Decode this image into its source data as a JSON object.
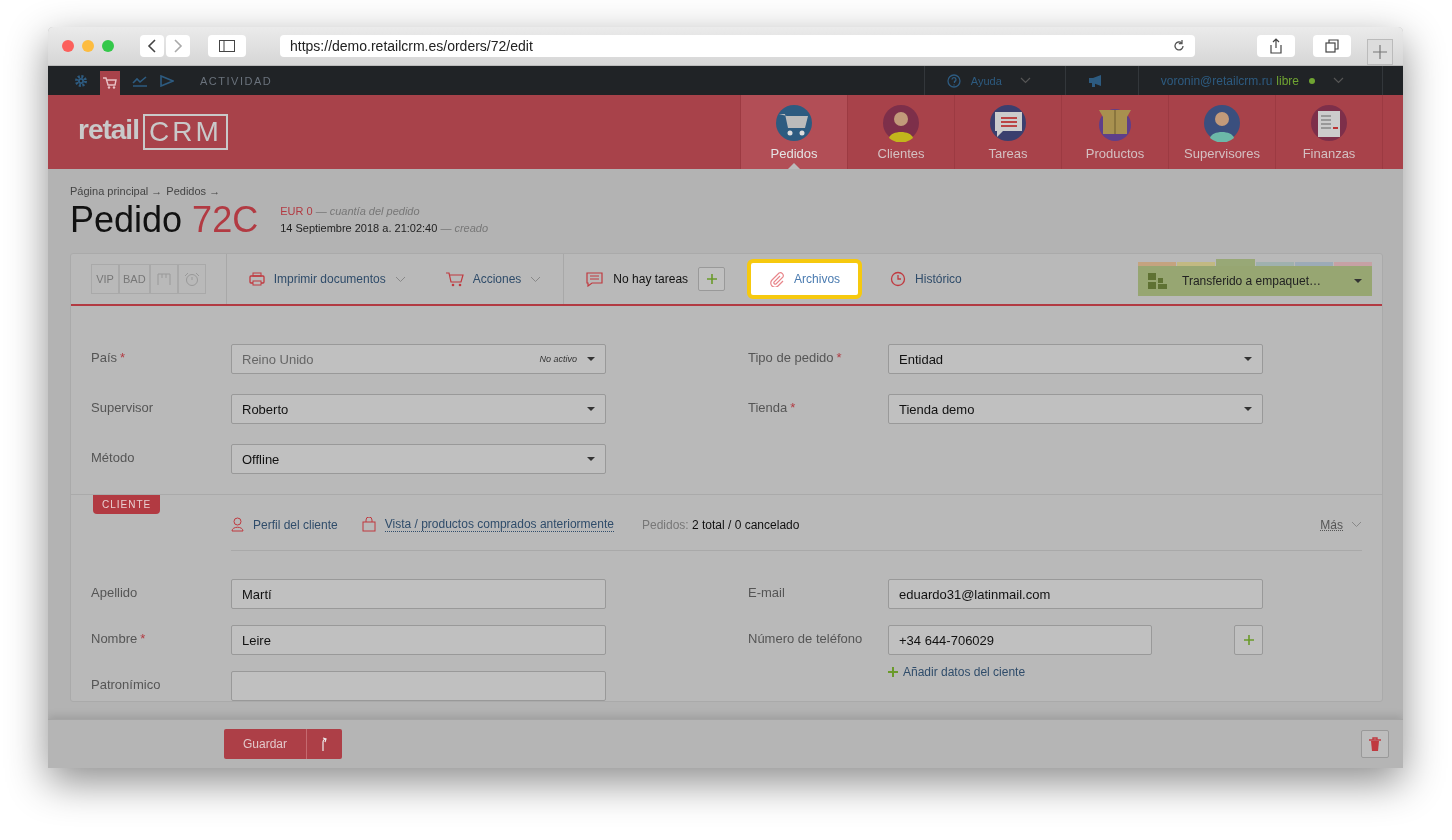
{
  "browser": {
    "url": "https://demo.retailcrm.es/orders/72/edit"
  },
  "topbar": {
    "activity": "ACTIVIDAD",
    "help": "Ayuda",
    "user": "voronin@retailcrm.ru",
    "plan": "libre"
  },
  "logo": {
    "text": "retail",
    "mark": "CRM"
  },
  "nav": [
    {
      "label": "Pedidos",
      "selected": true,
      "kind": "cart"
    },
    {
      "label": "Clientes",
      "selected": false,
      "kind": "person"
    },
    {
      "label": "Tareas",
      "selected": false,
      "kind": "chat"
    },
    {
      "label": "Productos",
      "selected": false,
      "kind": "box"
    },
    {
      "label": "Supervisores",
      "selected": false,
      "kind": "person"
    },
    {
      "label": "Finanzas",
      "selected": false,
      "kind": "sheet"
    }
  ],
  "breadcrumb": [
    "Página principal →",
    "Pedidos →"
  ],
  "order": {
    "title": "Pedido",
    "number": "72C",
    "amount": "EUR 0",
    "amount_note": "— cuantía del pedido",
    "date": "14 Septiembre 2018 a. 21:02:40",
    "date_note": "— creado"
  },
  "toolbar": {
    "tags": [
      "VIP",
      "BAD"
    ],
    "print": "Imprimir documentos",
    "actions": "Acciones",
    "tasks": "No hay tareas",
    "tabs": [
      {
        "label": "Archivos",
        "highlighted": true,
        "kind": "clip"
      },
      {
        "label": "Histórico",
        "highlighted": false,
        "kind": "clock"
      }
    ],
    "status": {
      "label": "Transferido a empaquet…",
      "segments": [
        {
          "color": "#c4a37f",
          "selected": false
        },
        {
          "color": "#c2b982",
          "selected": false
        },
        {
          "color": "#98a876",
          "selected": true
        },
        {
          "color": "#9fb1ae",
          "selected": false
        },
        {
          "color": "#9cabb7",
          "selected": false
        },
        {
          "color": "#c6a1a4",
          "selected": false
        }
      ]
    }
  },
  "order_fields": {
    "left": [
      {
        "label": "País",
        "required_mark": "*",
        "value": "Reino Unido",
        "note": "No activo",
        "disabled": true
      },
      {
        "label": "Supervisor",
        "value": "Roberto",
        "disabled": false
      },
      {
        "label": "Método",
        "value": "Offline",
        "disabled": false
      }
    ],
    "right": [
      {
        "label": "Tipo de pedido",
        "required_mark": "*",
        "value": "Entidad",
        "disabled": false
      },
      {
        "label": "Tienda",
        "required_mark": "*",
        "value": "Tienda demo",
        "disabled": false
      }
    ]
  },
  "client": {
    "badge": "CLIENTE",
    "profile": "Perfil del cliente",
    "history": "Vista / productos comprados anteriormente",
    "orders_label": "Pedidos:",
    "orders": "2 total / 0 cancelado",
    "more": "Más",
    "left": [
      {
        "label": "Apellido",
        "value": "Martí"
      },
      {
        "label": "Nombre",
        "required_mark": "*",
        "value": "Leire"
      },
      {
        "label": "Patronímico"
      }
    ],
    "right": [
      {
        "label": "E-mail",
        "value": "eduardo31@latinmail.com"
      },
      {
        "label": "Número de teléfono",
        "value": "+34 644-706029"
      }
    ],
    "add": "Añadir datos del ciente"
  },
  "footer": {
    "save": "Guardar"
  }
}
